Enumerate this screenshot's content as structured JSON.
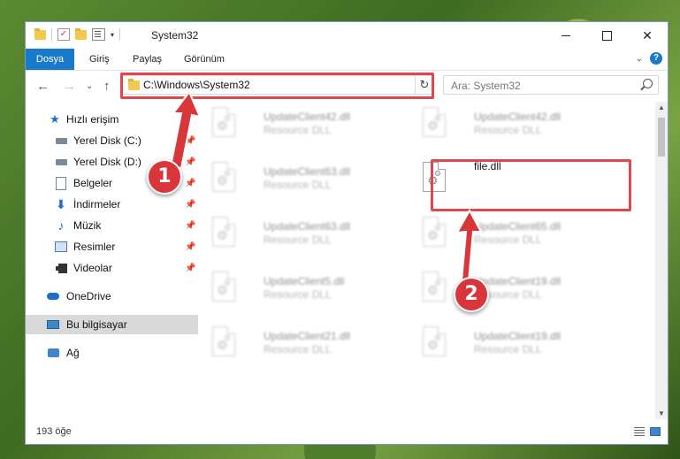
{
  "titlebar": {
    "title": "System32",
    "dropdown_glyph": "▾",
    "controls": {
      "minimize_icon": "minimize-icon",
      "maximize_icon": "maximize-icon",
      "close": "✕"
    }
  },
  "ribbon": {
    "tabs": [
      {
        "label": "Dosya",
        "active": true
      },
      {
        "label": "Giriş"
      },
      {
        "label": "Paylaş"
      },
      {
        "label": "Görünüm"
      }
    ],
    "expand_glyph": "⌄",
    "help_glyph": "?"
  },
  "nav": {
    "back": "←",
    "forward": "→",
    "recent": "⌄",
    "up": "↑",
    "address": "C:\\Windows\\System32",
    "address_dropdown": "⌄",
    "refresh": "↻",
    "search_placeholder": "Ara: System32"
  },
  "sidebar": {
    "items": [
      {
        "label": "Hızlı erişim",
        "icon": "star-icon",
        "glyph": "★"
      },
      {
        "label": "Yerel Disk (C:)",
        "icon": "drive-icon",
        "pinned": true
      },
      {
        "label": "Yerel Disk (D:)",
        "icon": "drive-icon",
        "pinned": true
      },
      {
        "label": "Belgeler",
        "icon": "documents-icon",
        "pinned": true
      },
      {
        "label": "İndirmeler",
        "icon": "downloads-icon",
        "glyph": "⬇",
        "pinned": true
      },
      {
        "label": "Müzik",
        "icon": "music-icon",
        "glyph": "♪",
        "pinned": true
      },
      {
        "label": "Resimler",
        "icon": "pictures-icon",
        "pinned": true
      },
      {
        "label": "Videolar",
        "icon": "videos-icon",
        "pinned": true
      },
      {
        "label": "OneDrive",
        "icon": "cloud-icon"
      },
      {
        "label": "Bu bilgisayar",
        "icon": "computer-icon",
        "selected": true
      },
      {
        "label": "Ağ",
        "icon": "network-icon"
      }
    ],
    "pin_glyph": "📌"
  },
  "files": [
    {
      "name": "UpdateClient42.dll",
      "type": "Resource DLL",
      "blurred": true
    },
    {
      "name": "UpdateClient42.dll",
      "type": "Resource DLL",
      "blurred": true
    },
    {
      "name": "UpdateClient63.dll",
      "type": "Resource DLL",
      "blurred": true
    },
    {
      "name": "file.dll",
      "type": "",
      "blurred": false,
      "highlighted": true
    },
    {
      "name": "UpdateClient63.dll",
      "type": "Resource DLL",
      "blurred": true
    },
    {
      "name": "UpdateClient65.dll",
      "type": "Resource DLL",
      "blurred": true
    },
    {
      "name": "UpdateClient5.dll",
      "type": "Resource DLL",
      "blurred": true
    },
    {
      "name": "UpdateClient19.dll",
      "type": "Resource DLL",
      "blurred": true
    },
    {
      "name": "UpdateClient21.dll",
      "type": "Resource DLL",
      "blurred": true
    },
    {
      "name": "UpdateClient19.dll",
      "type": "Resource DLL",
      "blurred": true
    }
  ],
  "gear_glyph": "⚙",
  "status": {
    "item_count": "193 öğe"
  },
  "scroll": {
    "up": "▲",
    "down": "▼"
  },
  "callouts": [
    {
      "number": "1",
      "color": "#d9363b"
    },
    {
      "number": "2",
      "color": "#d9363b"
    }
  ],
  "colors": {
    "accent": "#1979ca",
    "highlight": "#e0474c",
    "selection": "#d9d9d9"
  }
}
